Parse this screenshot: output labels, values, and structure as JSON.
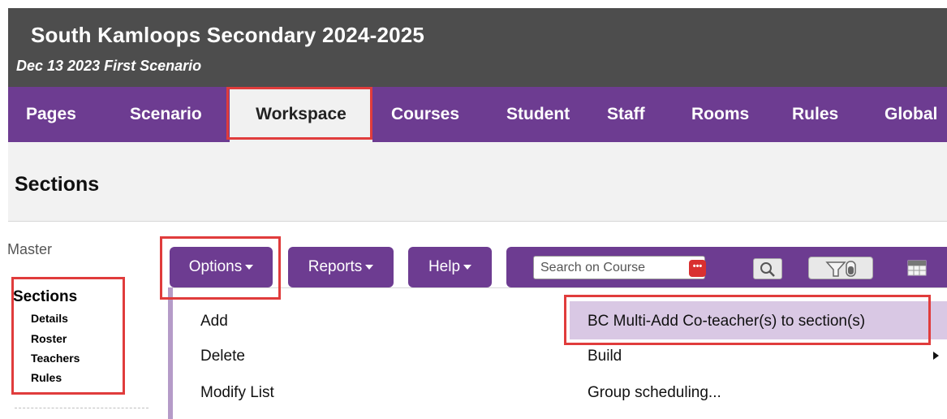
{
  "header": {
    "school_title": "South Kamloops Secondary 2024-2025",
    "scenario_title": "Dec 13 2023 First Scenario"
  },
  "nav": {
    "items": [
      {
        "label": "Pages"
      },
      {
        "label": "Scenario"
      },
      {
        "label": "Workspace",
        "active": true
      },
      {
        "label": "Courses"
      },
      {
        "label": "Student"
      },
      {
        "label": "Staff"
      },
      {
        "label": "Rooms"
      },
      {
        "label": "Rules"
      },
      {
        "label": "Global"
      }
    ]
  },
  "page": {
    "title": "Sections"
  },
  "sidebar": {
    "master_label": "Master",
    "sections_label": "Sections",
    "sub_items": [
      {
        "label": "Details"
      },
      {
        "label": "Roster"
      },
      {
        "label": "Teachers"
      },
      {
        "label": "Rules"
      }
    ]
  },
  "toolbar": {
    "options_label": "Options",
    "reports_label": "Reports",
    "help_label": "Help",
    "search_placeholder": "Search on Course"
  },
  "options_menu": {
    "items": [
      {
        "label": "Add"
      },
      {
        "label": "Delete"
      },
      {
        "label": "Modify List"
      }
    ]
  },
  "submenu": {
    "items": [
      {
        "label": "BC Multi-Add Co-teacher(s) to section(s)",
        "highlighted": true
      },
      {
        "label": "Build",
        "has_submenu": true
      },
      {
        "label": "Group scheduling..."
      }
    ]
  },
  "colors": {
    "header_bg": "#4d4d4d",
    "nav_purple": "#6d3c91",
    "highlight": "#d9c8e4",
    "annotation_red": "#e03c3c"
  }
}
